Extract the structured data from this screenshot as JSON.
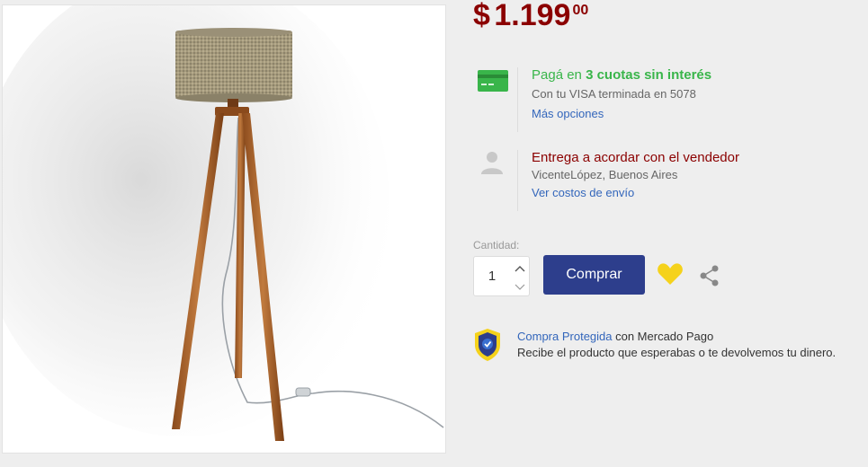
{
  "product": {
    "image_alt": "Lámpara de pie trípode de madera con pantalla de tela"
  },
  "price": {
    "symbol": "$",
    "amount": "1.199",
    "cents": "00",
    "color": "#8b0000"
  },
  "payment": {
    "title_prefix": "Pagá en ",
    "title_strong": "3 cuotas sin interés",
    "subtitle": "Con tu VISA terminada en 5078",
    "link": "Más opciones",
    "icon": "credit-card-icon",
    "color": "#39b54a"
  },
  "delivery": {
    "title": "Entrega a acordar con el vendedor",
    "location": "VicenteLópez, Buenos Aires",
    "link": "Ver costos de envío",
    "icon": "person-icon"
  },
  "quantity": {
    "label": "Cantidad:",
    "value": "1"
  },
  "actions": {
    "buy_label": "Comprar",
    "buy_color": "#2d3e8c",
    "favorite_icon": "heart-icon",
    "favorite_color": "#f5d21b",
    "share_icon": "share-icon"
  },
  "protection": {
    "link": "Compra Protegida",
    "suffix": " con Mercado Pago",
    "description": "Recibe el producto que esperabas o te devolvemos tu dinero.",
    "icon": "shield-check-icon"
  }
}
